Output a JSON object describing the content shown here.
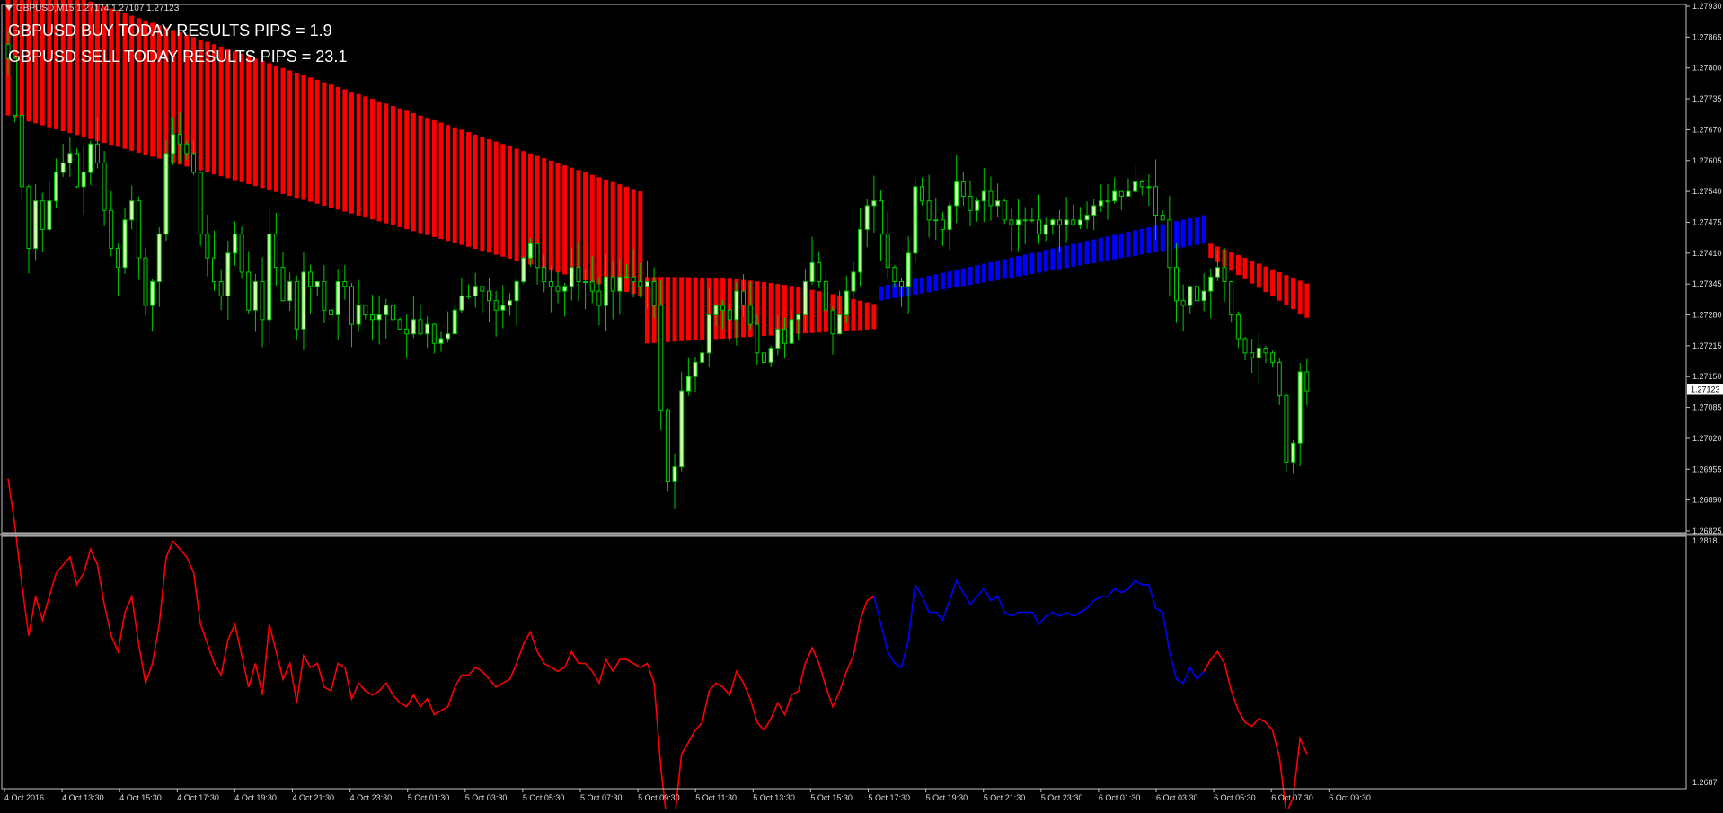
{
  "window": {
    "symbol_caption": "GBPUSD,M15",
    "ohlc_text": "1.27174 1.27107 1.27123"
  },
  "overlay": {
    "buy_text": "GBPUSD BUY TODAY RESULTS PIPS = 1.9",
    "sell_text": "GBPUSD SELL TODAY RESULTS PIPS = 23.1"
  },
  "price_axis": {
    "labels": [
      "1.27930",
      "1.27865",
      "1.27800",
      "1.27735",
      "1.27670",
      "1.27605",
      "1.27540",
      "1.27475",
      "1.27410",
      "1.27345",
      "1.27280",
      "1.27215",
      "1.27150",
      "1.27085",
      "1.27020",
      "1.26955",
      "1.26890",
      "1.26825"
    ],
    "current_price": "1.27123"
  },
  "indicator_axis": {
    "top": "1.2818",
    "bottom": "1.2687"
  },
  "time_axis": {
    "labels": [
      "4 Oct 2016",
      "4 Oct 13:30",
      "4 Oct 15:30",
      "4 Oct 17:30",
      "4 Oct 19:30",
      "4 Oct 21:30",
      "4 Oct 23:30",
      "5 Oct 01:30",
      "5 Oct 03:30",
      "5 Oct 05:30",
      "5 Oct 07:30",
      "5 Oct 09:30",
      "5 Oct 11:30",
      "5 Oct 13:30",
      "5 Oct 15:30",
      "5 Oct 17:30",
      "5 Oct 19:30",
      "5 Oct 21:30",
      "5 Oct 23:30",
      "6 Oct 01:30",
      "6 Oct 03:30",
      "6 Oct 05:30",
      "6 Oct 07:30",
      "6 Oct 09:30"
    ]
  },
  "colors": {
    "background": "#000000",
    "bull_candle": "#ccffaa",
    "bear_candle": "#000000",
    "wick": "#00cc00",
    "ribbon_sell": "#ff0000",
    "ribbon_buy": "#0000ff",
    "axis_text": "#dddddd",
    "frame": "#c0c0c0"
  },
  "chart_data": {
    "type": "candlestick",
    "price_range": [
      1.26825,
      1.2793
    ],
    "indicator_range": [
      1.2687,
      1.2818
    ],
    "candles_close": [
      1.2782,
      1.277,
      1.2755,
      1.2742,
      1.2752,
      1.2746,
      1.2752,
      1.2758,
      1.276,
      1.2762,
      1.2755,
      1.2758,
      1.2764,
      1.276,
      1.275,
      1.2742,
      1.2738,
      1.2748,
      1.2752,
      1.274,
      1.273,
      1.2735,
      1.2745,
      1.2762,
      1.2766,
      1.2764,
      1.2762,
      1.2758,
      1.2745,
      1.274,
      1.2735,
      1.2732,
      1.2741,
      1.2745,
      1.2737,
      1.2729,
      1.2735,
      1.2727,
      1.2745,
      1.2738,
      1.2731,
      1.2735,
      1.2725,
      1.2737,
      1.2734,
      1.2735,
      1.2729,
      1.2728,
      1.2735,
      1.2734,
      1.2726,
      1.273,
      1.2728,
      1.2727,
      1.2728,
      1.273,
      1.2727,
      1.2725,
      1.2724,
      1.2727,
      1.2724,
      1.2726,
      1.2722,
      1.2723,
      1.2724,
      1.2729,
      1.2732,
      1.2732,
      1.2734,
      1.2733,
      1.2731,
      1.2729,
      1.273,
      1.2731,
      1.2735,
      1.274,
      1.2743,
      1.2738,
      1.2735,
      1.2734,
      1.2733,
      1.2734,
      1.2738,
      1.2735,
      1.2735,
      1.2733,
      1.273,
      1.2736,
      1.2733,
      1.2736,
      1.2736,
      1.2735,
      1.2734,
      1.2735,
      1.273,
      1.2708,
      1.2693,
      1.2696,
      1.2712,
      1.2715,
      1.2718,
      1.272,
      1.2728,
      1.273,
      1.2729,
      1.2727,
      1.2733,
      1.273,
      1.2726,
      1.272,
      1.2718,
      1.2721,
      1.2725,
      1.2722,
      1.2727,
      1.2728,
      1.2735,
      1.2739,
      1.2735,
      1.2729,
      1.2724,
      1.2728,
      1.2733,
      1.2737,
      1.2746,
      1.2751,
      1.2752,
      1.2745,
      1.2738,
      1.2735,
      1.2734,
      1.2741,
      1.2755,
      1.2752,
      1.2748,
      1.2748,
      1.2746,
      1.2751,
      1.2756,
      1.2753,
      1.275,
      1.2752,
      1.2754,
      1.2751,
      1.2752,
      1.2748,
      1.2747,
      1.2748,
      1.2748,
      1.2748,
      1.2745,
      1.2747,
      1.2748,
      1.2747,
      1.2748,
      1.2747,
      1.2748,
      1.2749,
      1.2751,
      1.2752,
      1.2752,
      1.2754,
      1.2753,
      1.2754,
      1.2756,
      1.2755,
      1.2755,
      1.2749,
      1.2748,
      1.2738,
      1.2731,
      1.273,
      1.2734,
      1.2731,
      1.2733,
      1.2736,
      1.2738,
      1.2735,
      1.2728,
      1.2723,
      1.272,
      1.2719,
      1.2721,
      1.272,
      1.2718,
      1.2711,
      1.2697,
      1.2701,
      1.2716,
      1.2712
    ],
    "ribbon": [
      {
        "from": 0,
        "to": 92,
        "color": "sell"
      },
      {
        "from": 93,
        "to": 126,
        "color": "sell"
      },
      {
        "from": 127,
        "to": 174,
        "color": "buy"
      },
      {
        "from": 175,
        "to": 195,
        "color": "sell"
      }
    ],
    "indicator_series": [
      {
        "color": "sell",
        "from": 0,
        "to": 126
      },
      {
        "color": "buy",
        "from": 127,
        "to": 174
      },
      {
        "color": "sell",
        "from": 175,
        "to": 195
      }
    ]
  }
}
